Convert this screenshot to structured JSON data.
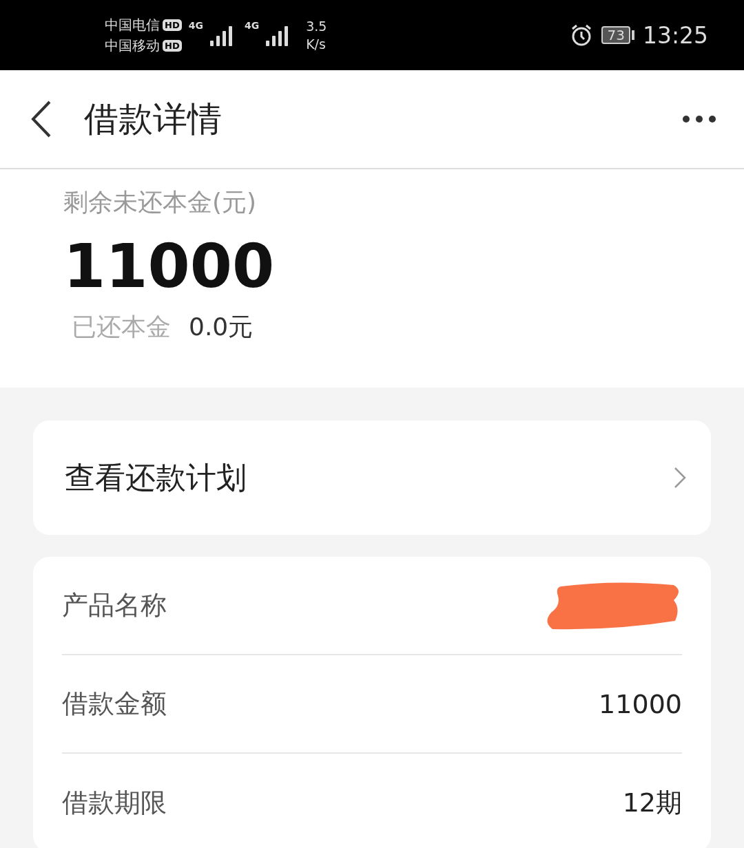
{
  "status_bar": {
    "carriers": [
      {
        "name": "中国电信",
        "badge": "HD"
      },
      {
        "name": "中国移动",
        "badge": "HD"
      }
    ],
    "networks": [
      "4G",
      "4G"
    ],
    "speed": [
      "3.5",
      "K/s"
    ],
    "battery": "73",
    "time": "13:25"
  },
  "header": {
    "title": "借款详情"
  },
  "summary": {
    "label": "剩余未还本金(元)",
    "amount": "11000",
    "repaid_label": "已还本金",
    "repaid_value": "0.0元"
  },
  "plan_link": {
    "label": "查看还款计划"
  },
  "details": [
    {
      "label": "产品名称",
      "redacted": true
    },
    {
      "label": "借款金额",
      "redacted": false,
      "value": "11000"
    },
    {
      "label": "借款期限",
      "redacted": false,
      "value": "12期"
    }
  ]
}
